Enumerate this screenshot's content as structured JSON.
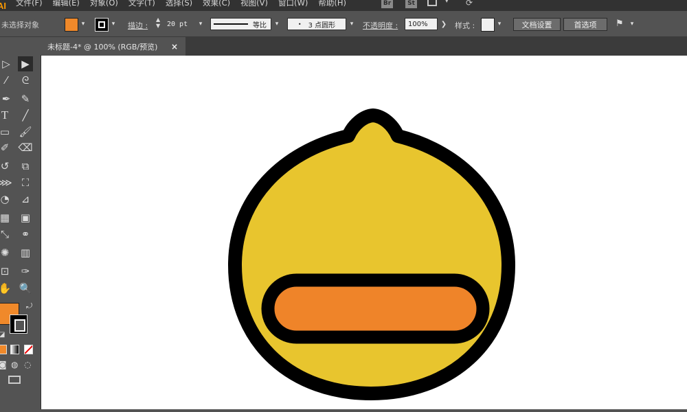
{
  "menubar": {
    "logo": "AI",
    "items": [
      "文件(F)",
      "编辑(E)",
      "对象(O)",
      "文字(T)",
      "选择(S)",
      "效果(C)",
      "视图(V)",
      "窗口(W)",
      "帮助(H)"
    ],
    "badges": [
      "Br",
      "St"
    ]
  },
  "control": {
    "selection": "未选择对象",
    "stroke_label": "描边 :",
    "stroke_weight": "20 pt",
    "profile": "等比",
    "brush": "3 点圆形",
    "opacity_label": "不透明度 :",
    "opacity": "100%",
    "style_label": "样式 :",
    "doc_setup": "文档设置",
    "prefs": "首选项",
    "fill_color": "#f0892a"
  },
  "document": {
    "tab_title": "未标题-4* @ 100% (RGB/预览)",
    "close": "×"
  },
  "tools": {
    "fill_color": "#f0892a",
    "stroke_color": "#000000"
  },
  "artwork": {
    "body_color": "#e8c52e",
    "mouth_color": "#ef8429",
    "outline_color": "#000000"
  }
}
